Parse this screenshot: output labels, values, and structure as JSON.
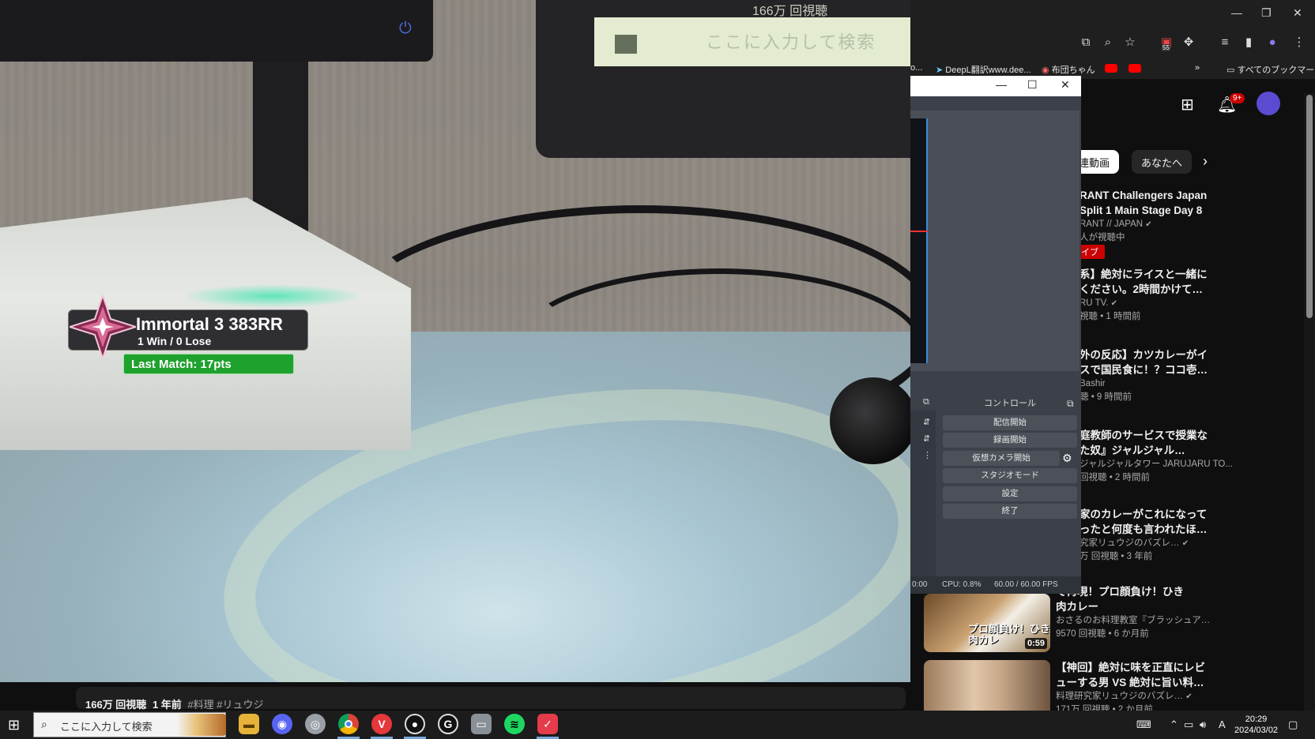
{
  "webcam": {
    "background_search_text": "ここに入力して検索",
    "background_top_text": "166万 回視聴",
    "rank_overlay": {
      "title": "Immortal 3  383RR",
      "record": "1 Win / 0 Lose",
      "last_match": "Last Match: 17pts"
    }
  },
  "video_meta": {
    "views": "166万 回視聴",
    "age": "1 年前",
    "tags": "#料理 #リュウジ"
  },
  "chrome": {
    "window_controls": [
      "—",
      "❐",
      "✕"
    ],
    "bookmarks": [
      {
        "label": "o..."
      },
      {
        "label": "DeepL翻訳www.dee..."
      },
      {
        "label": "布団ちゃん"
      },
      {
        "label": "すべてのブックマーク"
      }
    ],
    "notification_count": "9+",
    "tab_count": "55"
  },
  "youtube": {
    "chips": [
      "関連動画",
      "あなたへ"
    ],
    "recommendations": [
      {
        "title1": "RANT Challengers Japan",
        "title2": "Split 1 Main Stage Day 8",
        "channel": "RANT // JAPAN",
        "meta": "人が視聴中",
        "badge": "イブ"
      },
      {
        "title1": "系】絶対にライスと一緒に",
        "title2": "ください。2時間かけて…",
        "channel": "RU TV.",
        "meta": "視聴 • 1 時間前"
      },
      {
        "title1": "外の反応】カツカレーがイ",
        "title2": "スで国民食に！？ココ壱…",
        "channel": "Bashir",
        "meta": "聴 • 9 時間前"
      },
      {
        "title1": "庭教師のサービスで授業な",
        "title2": "た奴』ジャルジャル…",
        "channel": "ジャルジャルタワー JARUJARU TO...",
        "meta": "回視聴 • 2 時間前"
      },
      {
        "title1": "家のカレーがこれになって",
        "title2": "ったと何度も言われたほ…",
        "channel": "究家リュウジのバズレ…",
        "meta": "万 回視聴 • 3 年前"
      },
      {
        "title1": "で再現！プロ顔負け！ひき",
        "title2": "肉カレー",
        "channel": "おさるのお料理教室『ブラッシュア…",
        "meta": "9570 回視聴 • 6 か月前",
        "thumb_caption": "プロ顔負け！ひき肉カレ",
        "duration": "0:59"
      },
      {
        "title1": "【神回】絶対に味を正直にレビ",
        "title2": "ューする男 VS 絶対に旨い料…",
        "channel": "料理研究家リュウジのバズレ…",
        "meta": "171万 回視聴 • 2 か月前"
      }
    ]
  },
  "obs": {
    "controls_title": "コントロール",
    "buttons": [
      "配信開始",
      "録画開始",
      "仮想カメラ開始",
      "スタジオモード",
      "設定",
      "終了"
    ],
    "status_time": "0:00",
    "status_cpu": "CPU: 0.8%",
    "status_fps": "60.00 / 60.00 FPS"
  },
  "taskbar": {
    "search_placeholder": "ここに入力して検索",
    "time": "20:29",
    "date": "2024/03/02",
    "ime": "A"
  },
  "colors": {
    "rank_green": "#1fa12e",
    "yt_red": "#ff0000",
    "obs_bg": "#3c4049"
  }
}
